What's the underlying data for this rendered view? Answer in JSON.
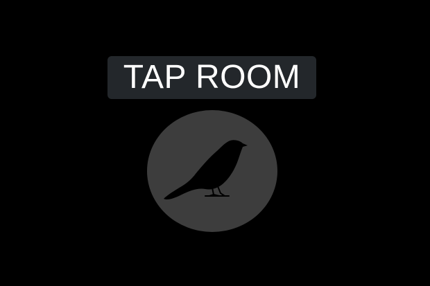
{
  "header": {
    "title": "TAP ROOM"
  },
  "avatar": {
    "icon": "bird-icon"
  },
  "colors": {
    "background": "#000000",
    "title_pill": "#23272b",
    "title_text": "#ffffff",
    "avatar_circle": "#3d3d3d",
    "bird_silhouette": "#000000"
  }
}
